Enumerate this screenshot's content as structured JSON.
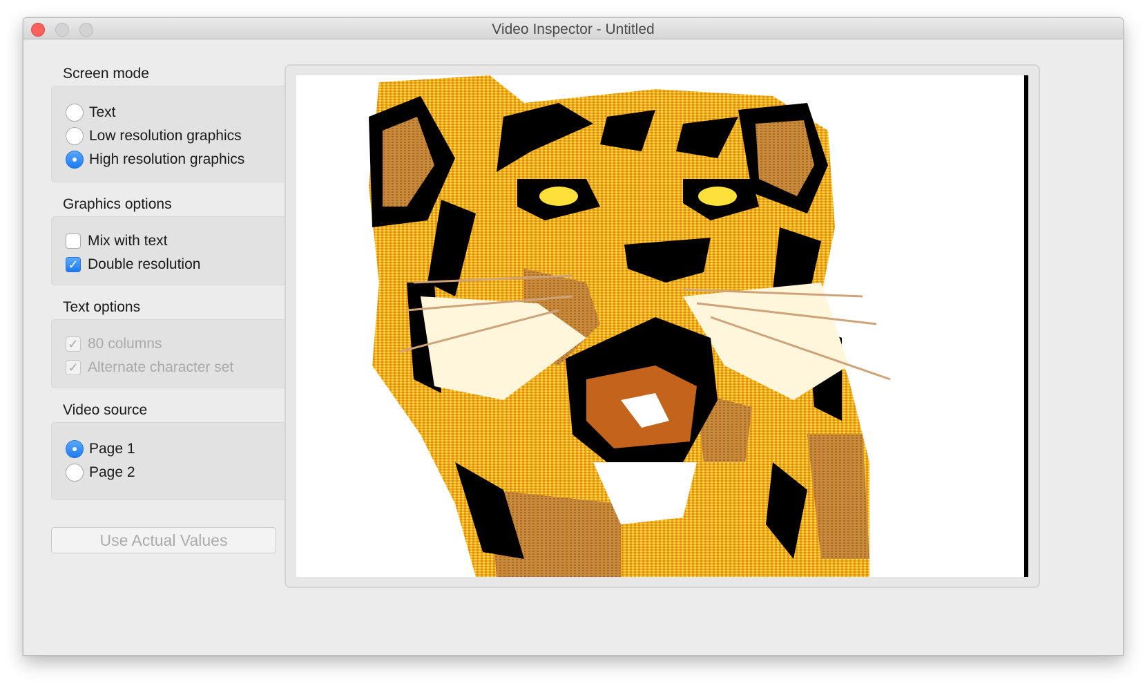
{
  "window": {
    "title": "Video Inspector - Untitled"
  },
  "screen_mode": {
    "title": "Screen mode",
    "options": [
      {
        "label": "Text",
        "selected": false
      },
      {
        "label": "Low resolution graphics",
        "selected": false
      },
      {
        "label": "High resolution graphics",
        "selected": true
      }
    ]
  },
  "graphics_options": {
    "title": "Graphics options",
    "options": [
      {
        "label": "Mix with text",
        "checked": false
      },
      {
        "label": "Double resolution",
        "checked": true
      }
    ]
  },
  "text_options": {
    "title": "Text options",
    "options": [
      {
        "label": "80 columns",
        "checked": true,
        "enabled": false
      },
      {
        "label": "Alternate character set",
        "checked": true,
        "enabled": false
      }
    ]
  },
  "video_source": {
    "title": "Video source",
    "options": [
      {
        "label": "Page 1",
        "selected": true
      },
      {
        "label": "Page 2",
        "selected": false
      }
    ]
  },
  "actions": {
    "use_actual_values": "Use Actual Values"
  },
  "colors": {
    "accent": "#1b7af3",
    "tiger_orange": "#f5a81c",
    "tiger_yellow": "#fde03a",
    "tiger_dark_orange": "#c4641c",
    "tiger_black": "#000000"
  },
  "preview": {
    "image": "tiger-icon"
  }
}
